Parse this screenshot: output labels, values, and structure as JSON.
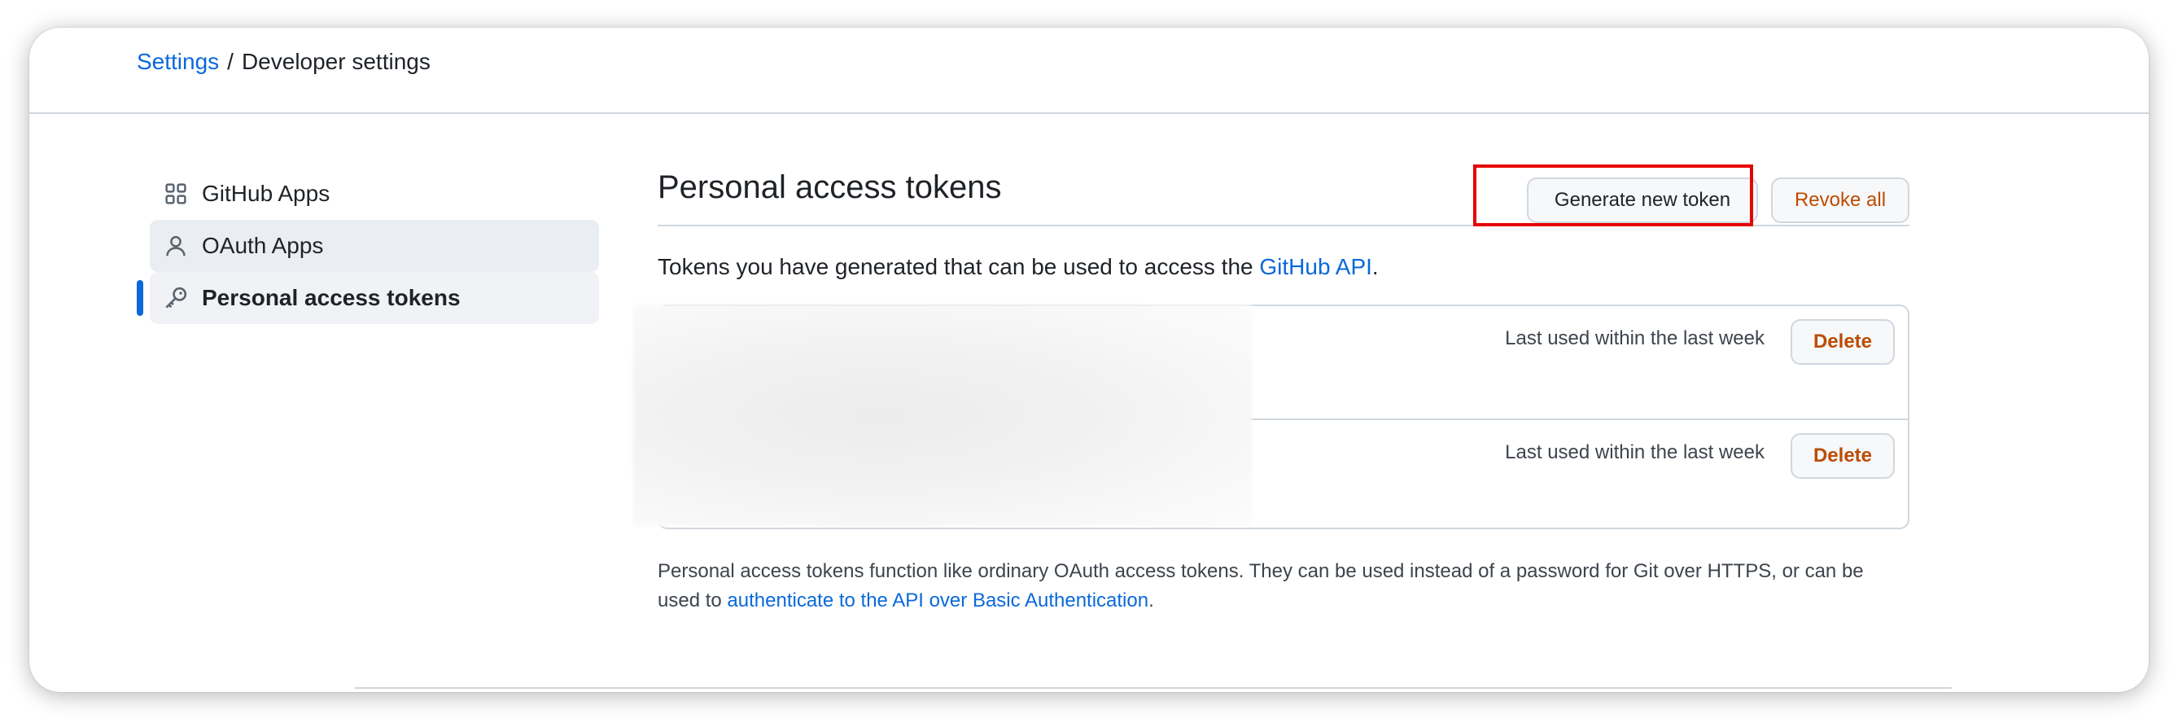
{
  "breadcrumb": {
    "root": "Settings",
    "separator": "/",
    "current": "Developer settings"
  },
  "sidebar": {
    "items": [
      {
        "label": "GitHub Apps",
        "icon": "apps-grid-icon",
        "state": "default"
      },
      {
        "label": "OAuth Apps",
        "icon": "person-icon",
        "state": "hover"
      },
      {
        "label": "Personal access tokens",
        "icon": "key-icon",
        "state": "active"
      }
    ]
  },
  "main": {
    "title": "Personal access tokens",
    "generate_button": "Generate new token",
    "revoke_all_button": "Revoke all",
    "intro_text": "Tokens you have generated that can be used to access the ",
    "intro_link": "GitHub API",
    "intro_end": ".",
    "tokens": [
      {
        "last_used": "Last used within the last week",
        "delete_label": "Delete"
      },
      {
        "last_used": "Last used within the last week",
        "delete_label": "Delete"
      }
    ],
    "footnote_text": "Personal access tokens function like ordinary OAuth access tokens. They can be used instead of a password for Git over HTTPS, or can be used to ",
    "footnote_link": "authenticate to the API over Basic Authentication",
    "footnote_end": "."
  },
  "colors": {
    "link": "#0969da",
    "danger_text": "#bc4c00",
    "highlight": "#e60000",
    "active_indicator": "#0969da"
  }
}
